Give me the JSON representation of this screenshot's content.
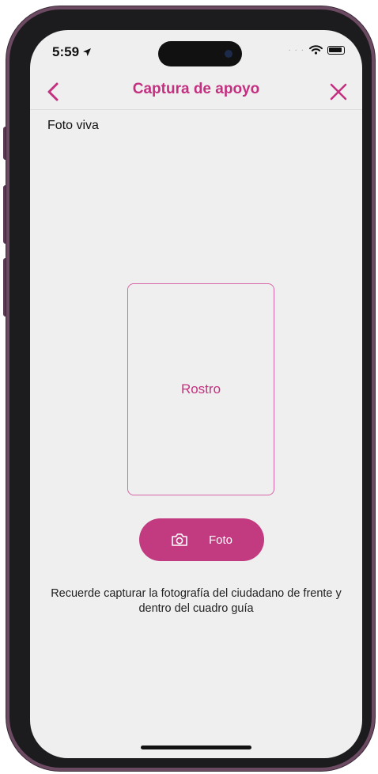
{
  "status_bar": {
    "time": "5:59",
    "signal": "· · ·"
  },
  "nav": {
    "title": "Captura de apoyo",
    "back_icon": "chevron-left-icon",
    "close_icon": "close-icon"
  },
  "section": {
    "label": "Foto viva"
  },
  "guide": {
    "label": "Rostro"
  },
  "photo_button": {
    "label": "Foto",
    "icon": "camera-icon"
  },
  "hint": {
    "text": "Recuerde capturar la fotografía del ciudadano de frente y dentro del cuadro guía"
  },
  "colors": {
    "accent": "#c2307f",
    "button": "#c23a80",
    "frame_border": "#d766a8",
    "screen_bg": "#f0efef"
  }
}
